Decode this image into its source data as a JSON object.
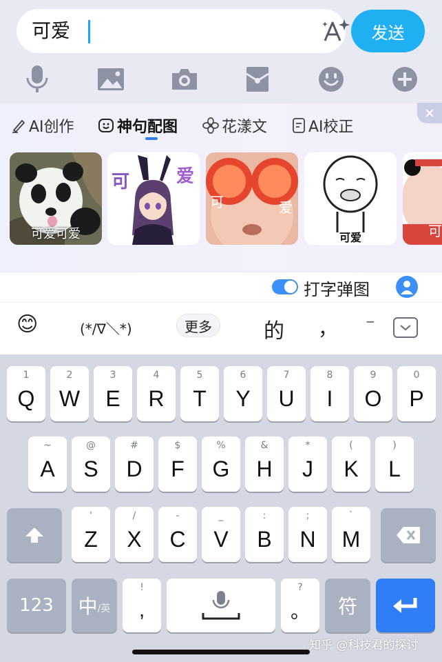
{
  "input": {
    "text": "可爱"
  },
  "send_label": "发送",
  "toolbar": [
    "mic-icon",
    "image-icon",
    "camera-icon",
    "red-packet-icon",
    "emoji-icon",
    "plus-icon"
  ],
  "feature_tabs": [
    {
      "icon": "ai-pen-icon",
      "label": "AI创作"
    },
    {
      "icon": "sticker-face-icon",
      "label": "神句配图"
    },
    {
      "icon": "flower-icon",
      "label": "花漾文"
    },
    {
      "icon": "doc-check-icon",
      "label": "AI校正"
    }
  ],
  "stickers": [
    {
      "caption": "可爱可爱"
    },
    {
      "caption_left": "可",
      "caption_right": "爱"
    },
    {
      "caption_left": "可",
      "caption_right": "爱"
    },
    {
      "caption": "可爱"
    },
    {
      "caption": "可"
    }
  ],
  "typing_sticker_label": "打字弹图",
  "candidates": {
    "emoji": "😊",
    "kaomoji": "(*/∇＼*)",
    "more": "更多",
    "c1": "的",
    "c2": "，",
    "c3": "⁻"
  },
  "keyboard": {
    "row1": [
      {
        "key": "Q",
        "hint": "1"
      },
      {
        "key": "W",
        "hint": "2"
      },
      {
        "key": "E",
        "hint": "3"
      },
      {
        "key": "R",
        "hint": "4"
      },
      {
        "key": "T",
        "hint": "5"
      },
      {
        "key": "Y",
        "hint": "6"
      },
      {
        "key": "U",
        "hint": "7"
      },
      {
        "key": "I",
        "hint": "8"
      },
      {
        "key": "O",
        "hint": "9"
      },
      {
        "key": "P",
        "hint": "0"
      }
    ],
    "row2": [
      {
        "key": "A",
        "hint": "~"
      },
      {
        "key": "S",
        "hint": "@"
      },
      {
        "key": "D",
        "hint": "#"
      },
      {
        "key": "F",
        "hint": "$"
      },
      {
        "key": "G",
        "hint": "%"
      },
      {
        "key": "H",
        "hint": "&"
      },
      {
        "key": "J",
        "hint": "*"
      },
      {
        "key": "K",
        "hint": "("
      },
      {
        "key": "L",
        "hint": ")"
      }
    ],
    "row3": [
      {
        "key": "Z",
        "hint": "'"
      },
      {
        "key": "X",
        "hint": "/"
      },
      {
        "key": "C",
        "hint": "-"
      },
      {
        "key": "V",
        "hint": "_"
      },
      {
        "key": "B",
        "hint": ":"
      },
      {
        "key": "N",
        "hint": ";"
      },
      {
        "key": "M",
        "hint": "`"
      }
    ],
    "num_label": "123",
    "lang_main": "中",
    "lang_sub": "/英",
    "punct_main": ",",
    "punct_hint": "!",
    "period_main": "。",
    "period_hint": "?",
    "symbol_label": "符"
  },
  "watermark": "知乎 @科技君的探讨"
}
